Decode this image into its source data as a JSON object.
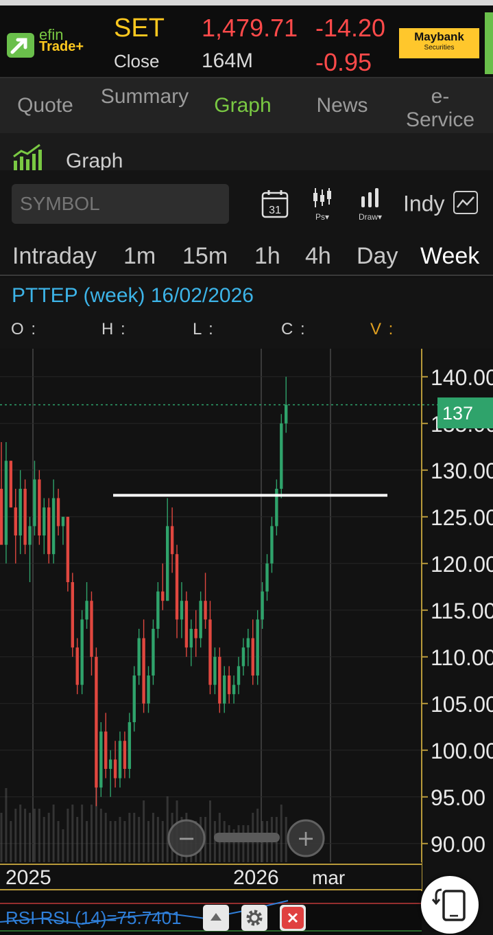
{
  "header": {
    "logo_efin": "efin",
    "logo_trade": "Trade+",
    "index_name": "SET",
    "index_status": "Close",
    "index_value": "1,479.71",
    "index_volume": "164M",
    "index_change": "-14.20",
    "index_change_pct": "-0.95",
    "broker_name": "Maybank",
    "broker_sub": "Securities"
  },
  "tabs": [
    {
      "label": "Quote"
    },
    {
      "label": "Summary"
    },
    {
      "label": "Graph"
    },
    {
      "label": "News"
    },
    {
      "label": "e-Service"
    }
  ],
  "section": {
    "title": "Graph",
    "icon": "chart-growth-icon"
  },
  "toolbar": {
    "symbol_placeholder": "SYMBOL",
    "calendar_day": "31",
    "ps_label": "Ps▾",
    "draw_label": "Draw▾",
    "indy_label": "Indy"
  },
  "timeframes": [
    "Intraday",
    "1m",
    "15m",
    "1h",
    "4h",
    "Day",
    "Week"
  ],
  "chart_info": {
    "title": "PTTEP (week) 16/02/2026",
    "o_label": "O :",
    "h_label": "H :",
    "l_label": "L :",
    "c_label": "C :",
    "v_label": "V :"
  },
  "chart_data": {
    "type": "candlestick",
    "symbol": "PTTEP",
    "interval": "week",
    "ylim": [
      88,
      143
    ],
    "y_ticks": [
      "140.00",
      "135.00",
      "130.00",
      "125.00",
      "120.00",
      "115.00",
      "110.00",
      "105.00",
      "100.00",
      "95.00",
      "90.00"
    ],
    "x_labels": [
      "2025",
      "2026",
      "mar"
    ],
    "last_price": "137",
    "resistance_level": 127.3,
    "candles": [
      [
        128,
        133,
        126,
        122
      ],
      [
        122,
        133,
        120,
        131
      ],
      [
        131,
        131,
        126,
        126
      ],
      [
        126,
        128,
        120,
        123
      ],
      [
        123,
        130,
        121,
        128
      ],
      [
        128,
        129,
        121,
        122
      ],
      [
        122,
        125,
        118,
        124
      ],
      [
        124,
        131,
        123,
        129
      ],
      [
        129,
        130,
        122,
        123
      ],
      [
        123,
        127,
        121,
        126
      ],
      [
        126,
        127,
        120,
        121
      ],
      [
        121,
        129,
        120,
        127
      ],
      [
        127,
        128,
        123,
        124
      ],
      [
        124,
        125,
        122,
        125
      ],
      [
        125,
        125,
        117,
        118
      ],
      [
        118,
        119,
        110,
        111
      ],
      [
        111,
        112,
        106,
        107
      ],
      [
        107,
        115,
        106,
        114
      ],
      [
        114,
        118,
        113,
        116
      ],
      [
        116,
        117,
        108,
        110
      ],
      [
        110,
        111,
        94,
        96
      ],
      [
        96,
        103,
        95,
        102
      ],
      [
        102,
        104,
        97,
        98
      ],
      [
        98,
        100,
        95,
        99
      ],
      [
        99,
        101,
        96,
        97
      ],
      [
        97,
        102,
        96,
        101
      ],
      [
        101,
        102,
        97,
        98
      ],
      [
        98,
        104,
        97,
        103
      ],
      [
        103,
        109,
        102,
        108
      ],
      [
        108,
        113,
        107,
        112
      ],
      [
        112,
        114,
        104,
        105
      ],
      [
        105,
        109,
        104,
        108
      ],
      [
        108,
        114,
        107,
        113
      ],
      [
        113,
        118,
        112,
        117
      ],
      [
        117,
        120,
        115,
        116
      ],
      [
        116,
        127,
        116,
        124
      ],
      [
        124,
        126,
        119,
        121
      ],
      [
        121,
        122,
        112,
        114
      ],
      [
        114,
        118,
        112,
        116
      ],
      [
        116,
        117,
        110,
        111
      ],
      [
        111,
        114,
        109,
        113
      ],
      [
        113,
        115,
        110,
        112
      ],
      [
        112,
        117,
        111,
        116
      ],
      [
        116,
        119,
        113,
        114
      ],
      [
        114,
        116,
        106,
        107
      ],
      [
        107,
        111,
        106,
        110
      ],
      [
        110,
        111,
        104,
        105
      ],
      [
        105,
        109,
        104,
        108
      ],
      [
        108,
        109,
        105,
        106
      ],
      [
        106,
        108,
        105,
        107
      ],
      [
        107,
        110,
        106,
        109
      ],
      [
        109,
        112,
        108,
        111
      ],
      [
        111,
        113,
        109,
        112
      ],
      [
        112,
        114,
        107,
        108
      ],
      [
        108,
        115,
        107,
        114
      ],
      [
        114,
        118,
        113,
        117
      ],
      [
        117,
        121,
        116,
        120
      ],
      [
        120,
        125,
        119,
        124
      ],
      [
        124,
        129,
        123,
        128
      ],
      [
        128,
        136,
        127,
        135
      ],
      [
        135,
        140,
        134,
        137
      ]
    ]
  },
  "bottom": {
    "rsi_label": "RSI RSI (14)=75.7401",
    "zoom_out": "−",
    "zoom_in": "+"
  },
  "colors": {
    "up": "#2fa36b",
    "down": "#e0473f",
    "accent_green": "#7ac943",
    "accent_yellow": "#ffc91f",
    "price_label": "#2fa36b",
    "rsi_blue": "#2f7fd9"
  }
}
